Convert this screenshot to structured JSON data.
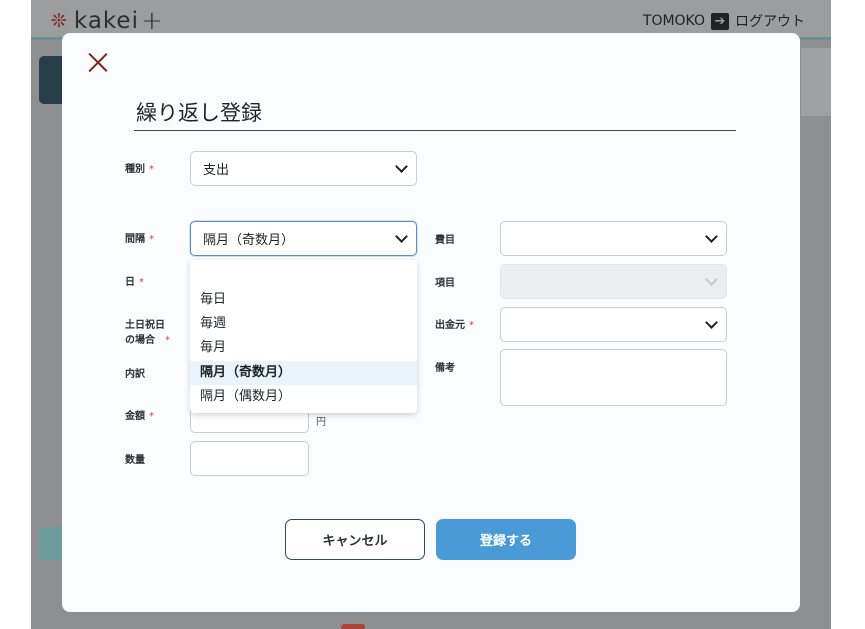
{
  "app": {
    "logo_text": "kakei",
    "logo_plus": "+",
    "user_name": "TOMOKO",
    "logout_label": "ログアウト"
  },
  "modal": {
    "title": "繰り返し登録",
    "fields": {
      "type": {
        "label": "種別",
        "value": "支出"
      },
      "interval": {
        "label": "間隔",
        "value": "隔月（奇数月）"
      },
      "day": {
        "label": "日"
      },
      "holiday_line1": "土日祝日",
      "holiday_line2": "の場合",
      "breakdown": {
        "label": "内訳"
      },
      "amount": {
        "label": "金額",
        "unit": "円"
      },
      "quantity": {
        "label": "数量"
      },
      "expense_category": {
        "label": "費目",
        "value": ""
      },
      "item": {
        "label": "項目",
        "value": ""
      },
      "source": {
        "label": "出金元",
        "value": ""
      },
      "memo": {
        "label": "備考",
        "value": ""
      }
    },
    "required_mark": "*",
    "interval_options": [
      "毎日",
      "毎週",
      "毎月",
      "隔月（奇数月）",
      "隔月（偶数月）"
    ],
    "interval_selected_index": 3,
    "cancel_label": "キャンセル",
    "submit_label": "登録する"
  },
  "colors": {
    "accent": "#4a9ad8",
    "required": "#d64646",
    "brand": "#7a2a22"
  }
}
